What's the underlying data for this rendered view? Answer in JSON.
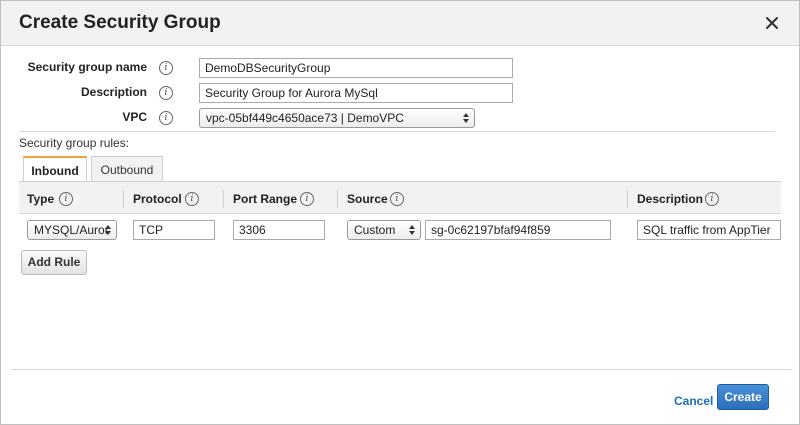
{
  "dialog": {
    "title": "Create Security Group"
  },
  "form": {
    "name_label": "Security group name",
    "name_value": "DemoDBSecurityGroup",
    "description_label": "Description",
    "description_value": "Security Group for Aurora MySql",
    "vpc_label": "VPC",
    "vpc_value": "vpc-05bf449c4650ace73 | DemoVPC"
  },
  "rules": {
    "section_label": "Security group rules:",
    "tabs": [
      {
        "label": "Inbound",
        "active": true
      },
      {
        "label": "Outbound",
        "active": false
      }
    ],
    "columns": [
      "Type",
      "Protocol",
      "Port Range",
      "Source",
      "Description"
    ],
    "rows": [
      {
        "type": "MYSQL/Auror",
        "protocol": "TCP",
        "port_range": "3306",
        "source_mode": "Custom",
        "source_value": "sg-0c62197bfaf94f859",
        "description": "SQL traffic from AppTier"
      }
    ],
    "add_rule_label": "Add Rule"
  },
  "footer": {
    "cancel_label": "Cancel",
    "create_label": "Create"
  },
  "icons": {
    "info": "i"
  },
  "colors": {
    "primary_button": "#2b6fb9",
    "link": "#1a6fb5",
    "active_tab_accent": "#f0a33a"
  }
}
